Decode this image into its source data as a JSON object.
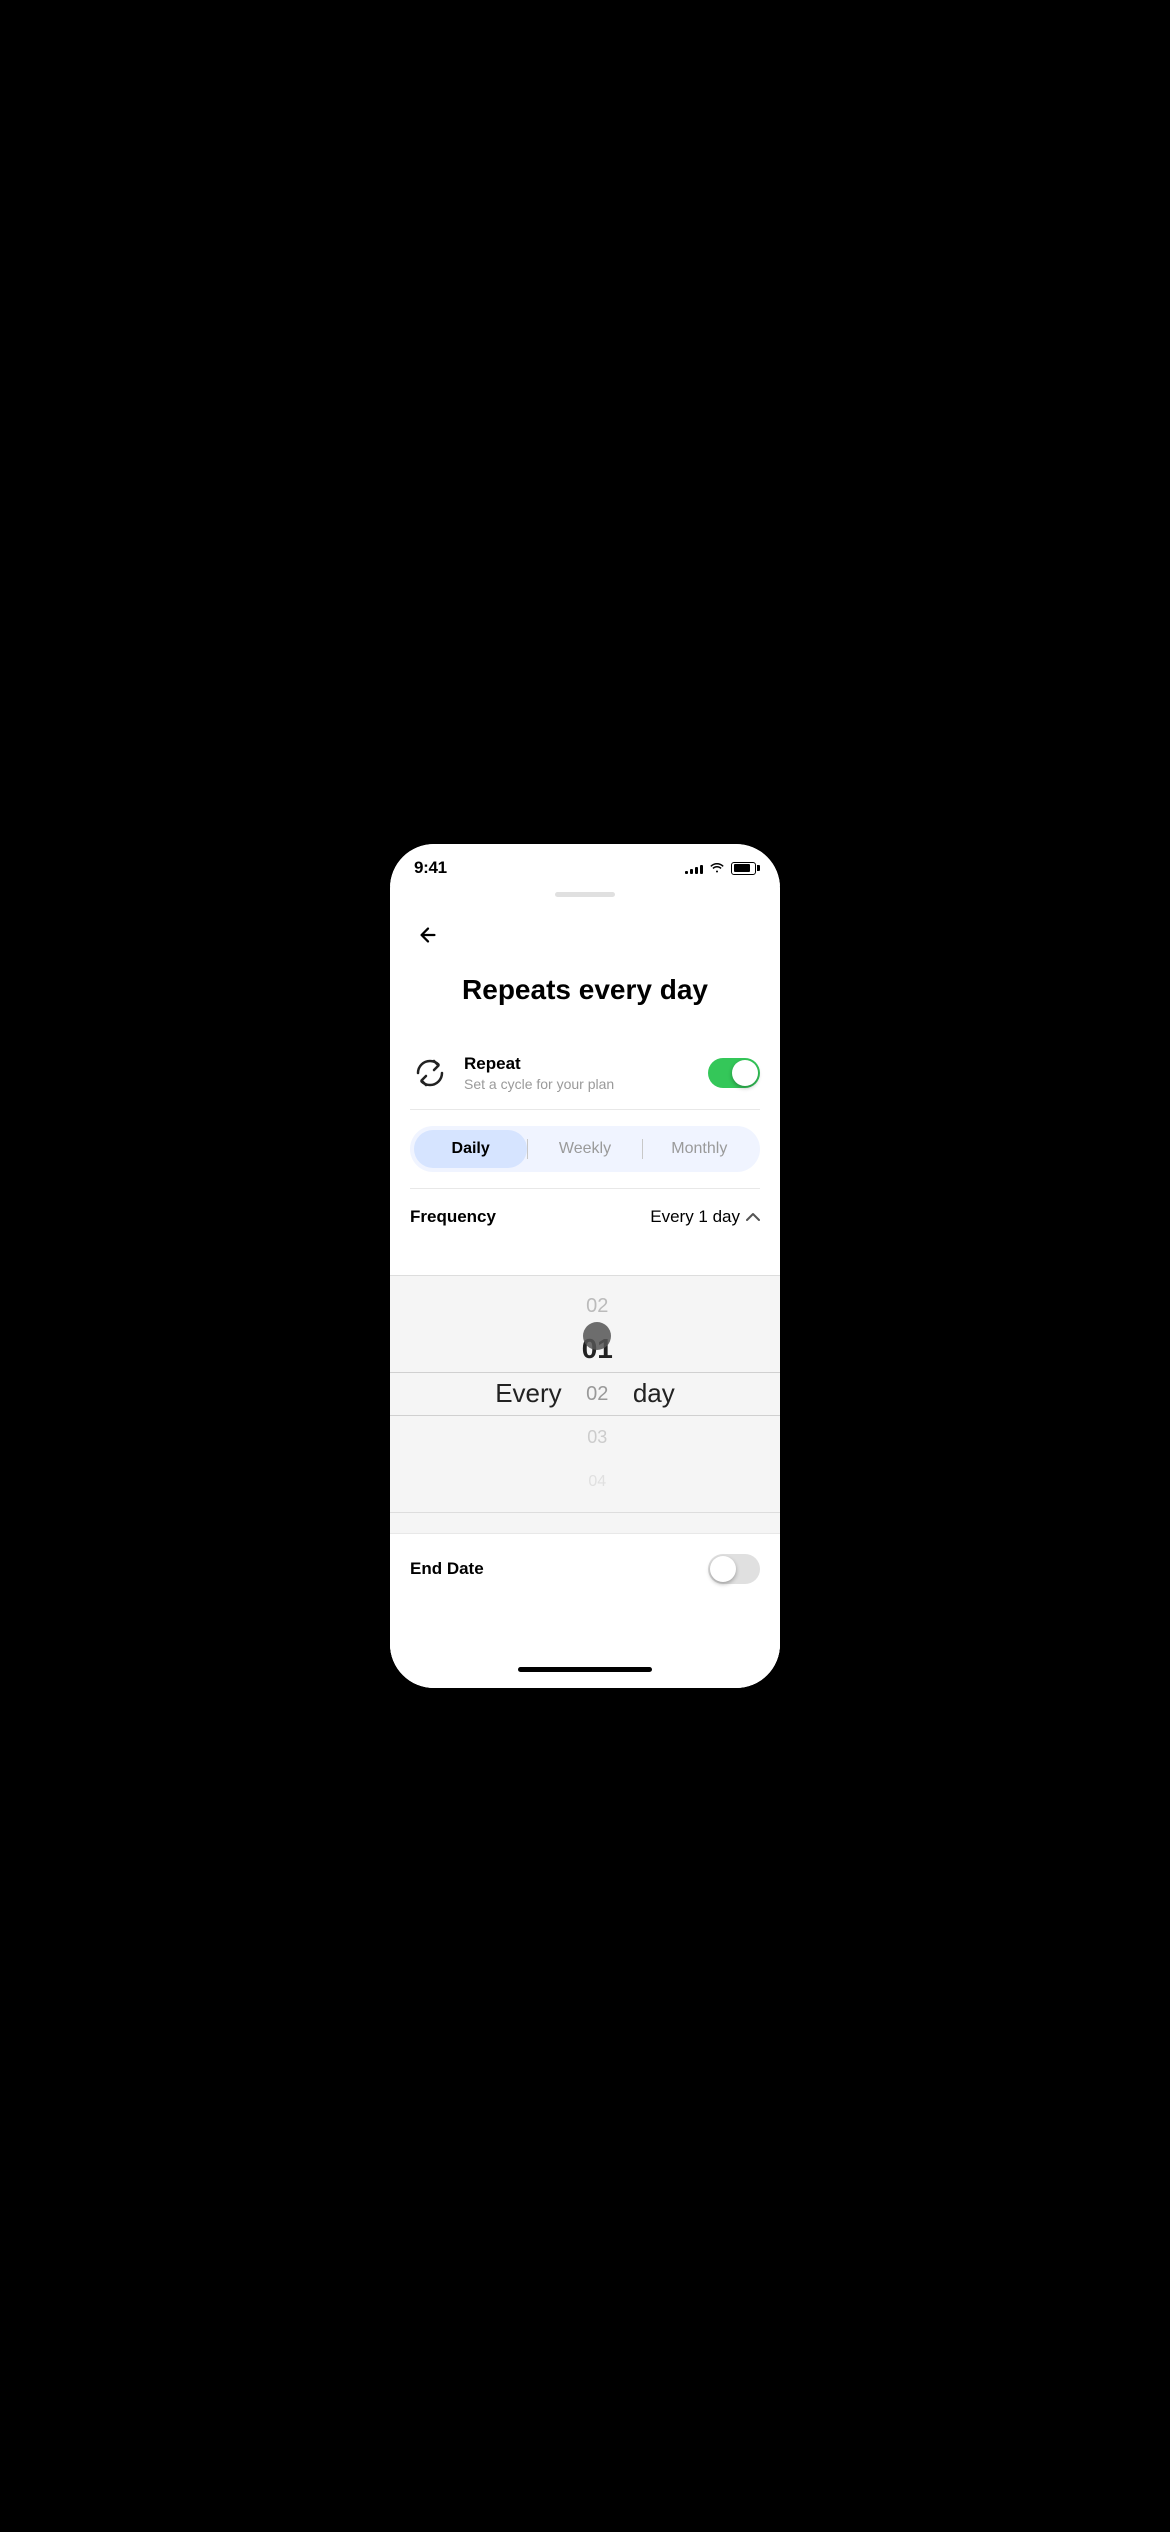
{
  "statusBar": {
    "time": "9:41",
    "signal": [
      3,
      5,
      7,
      9,
      11
    ],
    "batteryLevel": 80
  },
  "header": {
    "backLabel": "←",
    "title": "Repeats every day"
  },
  "repeatSection": {
    "iconAlt": "repeat",
    "label": "Repeat",
    "sublabel": "Set a cycle for your plan",
    "toggleEnabled": true
  },
  "tabs": {
    "items": [
      {
        "id": "daily",
        "label": "Daily",
        "active": true
      },
      {
        "id": "weekly",
        "label": "Weekly",
        "active": false
      },
      {
        "id": "monthly",
        "label": "Monthly",
        "active": false
      }
    ]
  },
  "frequency": {
    "label": "Frequency",
    "value": "Every 1  day",
    "expanded": true
  },
  "picker": {
    "everyLabel": "Every",
    "dayLabel": "day",
    "items": [
      {
        "value": "02",
        "state": "near"
      },
      {
        "value": "01",
        "state": "selected"
      },
      {
        "value": "02",
        "state": "near"
      },
      {
        "value": "03",
        "state": "far"
      },
      {
        "value": "04",
        "state": "farthest"
      }
    ],
    "scrollDot": true
  },
  "endDate": {
    "label": "End Date",
    "toggleEnabled": false
  },
  "homeIndicator": {
    "visible": true
  }
}
